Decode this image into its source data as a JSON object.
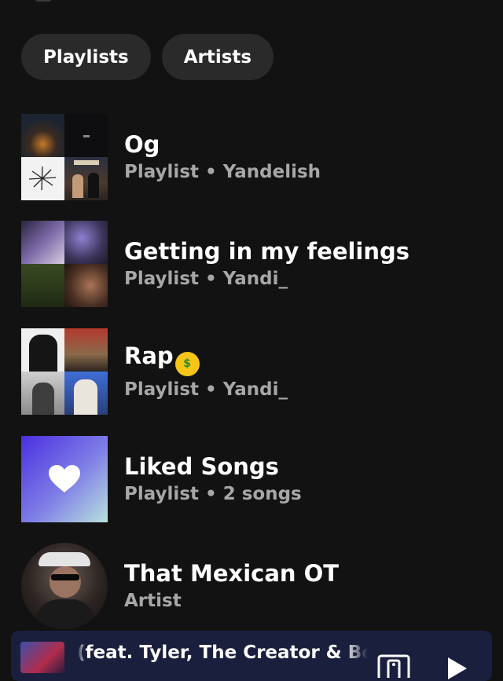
{
  "filters": {
    "chips": [
      {
        "label": "Playlists"
      },
      {
        "label": "Artists"
      }
    ]
  },
  "library": {
    "items": [
      {
        "title": "Og",
        "subtitle": "Playlist • Yandelish",
        "kind": "playlist",
        "cover": "mosaic"
      },
      {
        "title": "Getting in my feelings",
        "subtitle": "Playlist • Yandi_",
        "kind": "playlist",
        "cover": "mosaic"
      },
      {
        "title": "Rap",
        "title_emoji": "money-mouth-face",
        "subtitle": "Playlist • Yandi_",
        "kind": "playlist",
        "cover": "mosaic"
      },
      {
        "title": "Liked Songs",
        "subtitle": "Playlist • 2 songs",
        "kind": "playlist",
        "cover": "heart-icon"
      },
      {
        "title": "That Mexican OT",
        "subtitle": "Artist",
        "kind": "artist",
        "cover": "avatar"
      }
    ]
  },
  "now_playing": {
    "title": "(feat. Tyler, The Creator & Boots",
    "device_icon": "connect-device-icon",
    "play_icon": "play-icon"
  },
  "colors": {
    "background": "#121212",
    "chip": "#2a2a2a",
    "subtitle": "#a7a7a7",
    "now_playing_bar": "#1b1f3e"
  }
}
